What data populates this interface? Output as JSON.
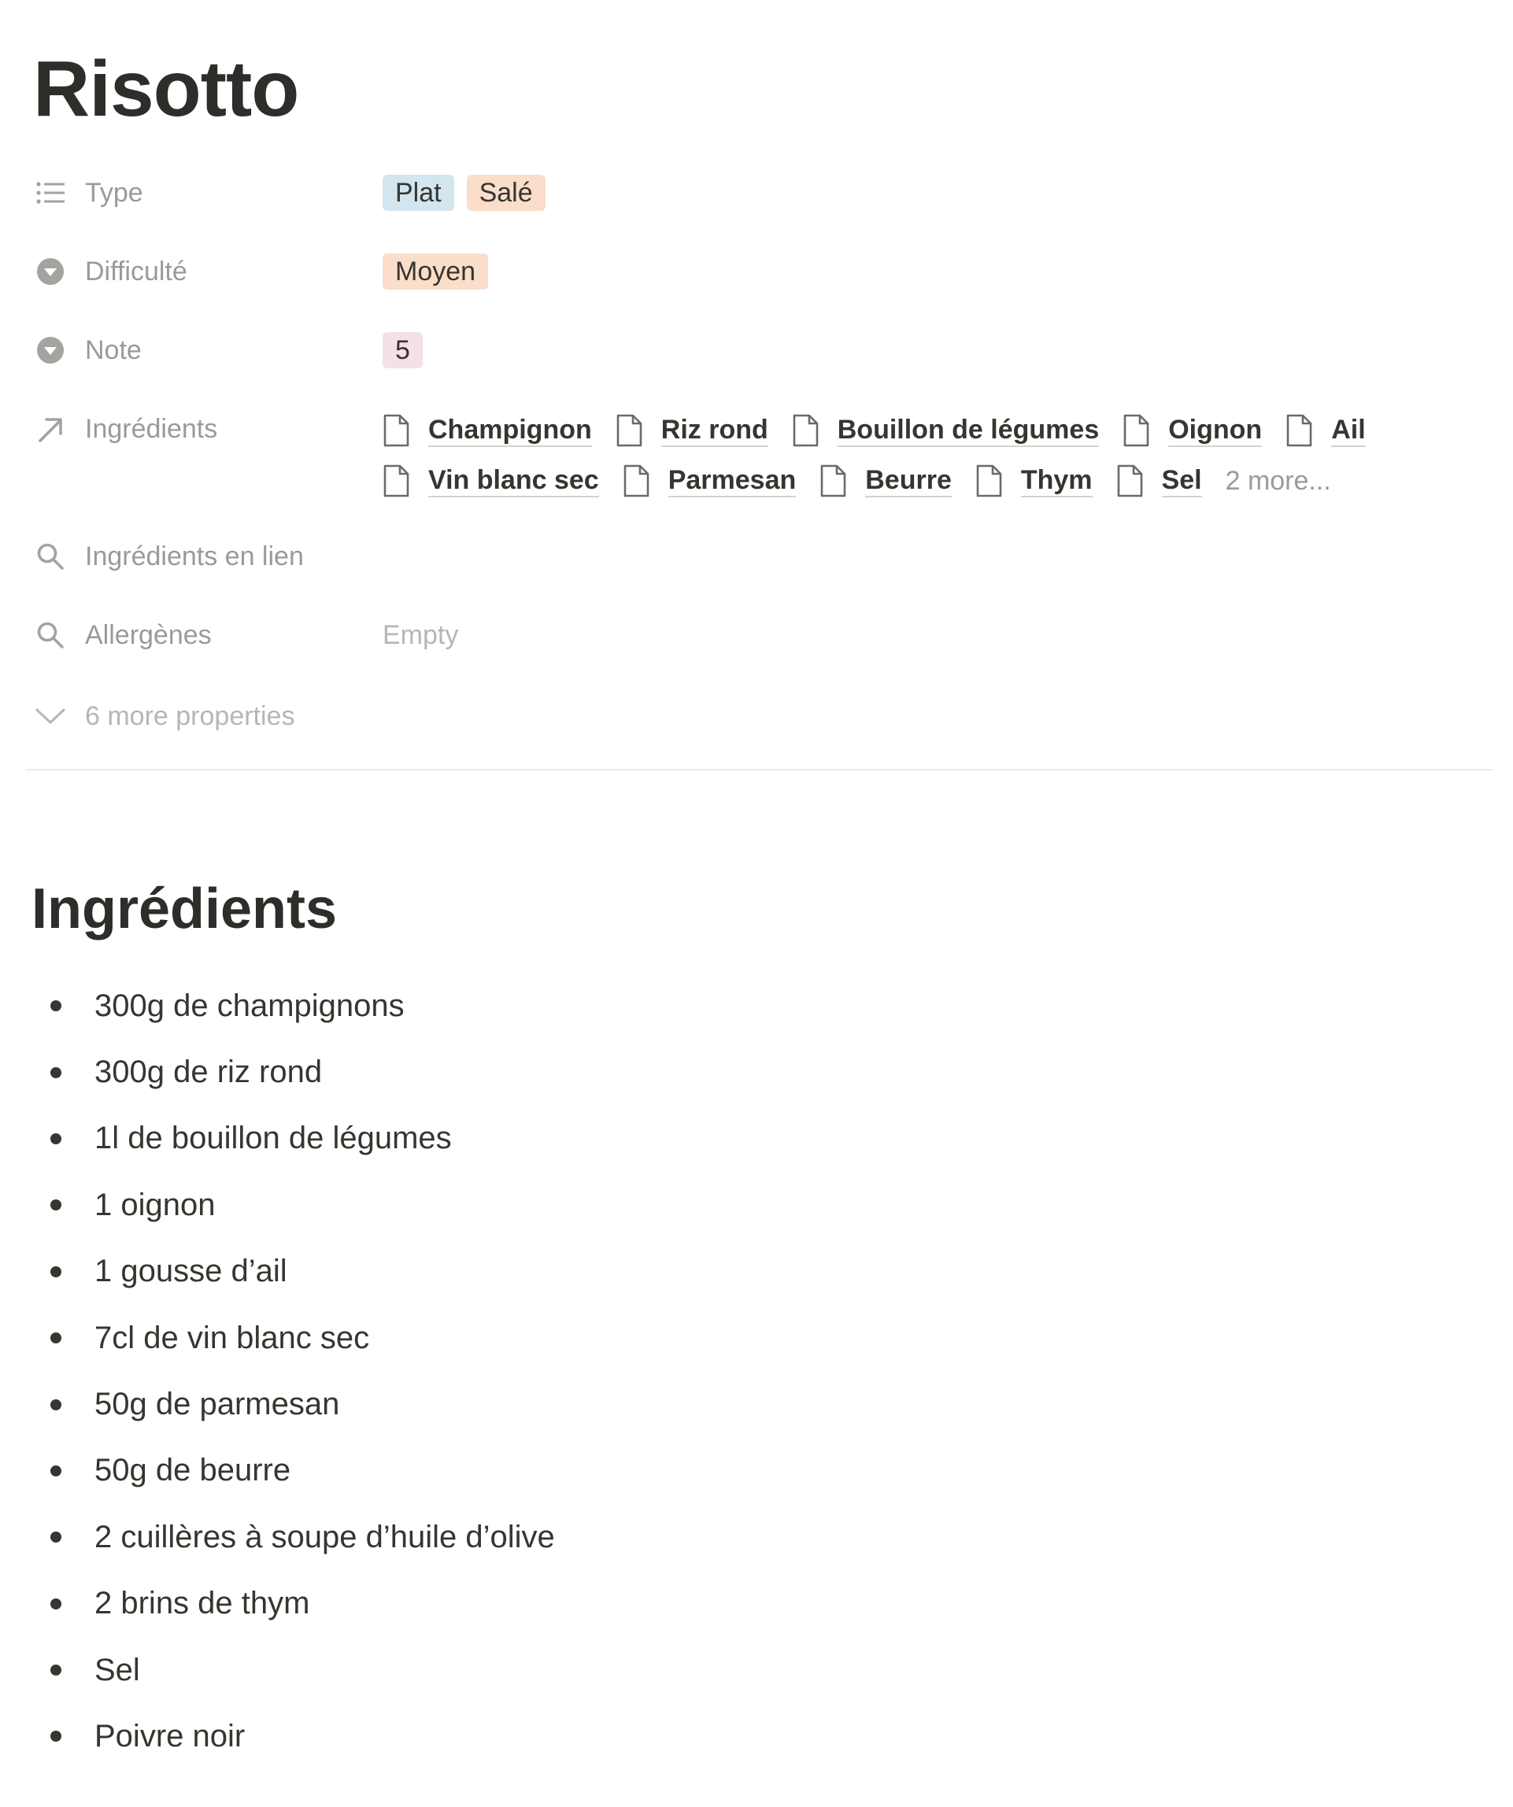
{
  "page": {
    "title": "Risotto"
  },
  "properties": {
    "type": {
      "label": "Type",
      "icon": "list-icon",
      "tags": [
        {
          "text": "Plat",
          "color": "#d3e5ef"
        },
        {
          "text": "Salé",
          "color": "#fadec9"
        }
      ]
    },
    "difficulte": {
      "label": "Difficulté",
      "icon": "select-icon",
      "tags": [
        {
          "text": "Moyen",
          "color": "#fadec9"
        }
      ]
    },
    "note": {
      "label": "Note",
      "icon": "select-icon",
      "tags": [
        {
          "text": "5",
          "color": "#f5e0e9"
        }
      ]
    },
    "ingredients": {
      "label": "Ingrédients",
      "icon": "relation-arrow-icon",
      "items_line1": [
        "Champignon",
        "Riz rond",
        "Bouillon de légumes",
        "Oignon",
        "Ail"
      ],
      "items_line2": [
        "Vin blanc sec",
        "Parmesan",
        "Beurre",
        "Thym",
        "Sel"
      ],
      "more": "2 more..."
    },
    "ingredients_en_lien": {
      "label": "Ingrédients en lien",
      "icon": "search-icon"
    },
    "allergenes": {
      "label": "Allergènes",
      "icon": "search-icon",
      "value": "Empty"
    },
    "more_properties": {
      "label": "6 more properties",
      "icon": "chevron-down-icon"
    }
  },
  "content": {
    "heading": "Ingrédients",
    "items": [
      "300g de champignons",
      "300g de riz rond",
      "1l de bouillon de légumes",
      "1 oignon",
      "1 gousse d’ail",
      "7cl de vin blanc sec",
      "50g de parmesan",
      "50g de beurre",
      "2 cuillères à soupe d’huile d’olive",
      "2 brins de thym",
      "Sel",
      "Poivre noir"
    ]
  },
  "colors": {
    "text": "#37352f",
    "muted": "#9b9a97",
    "placeholder": "#b7b6b3",
    "divider": "#ebeae7"
  }
}
